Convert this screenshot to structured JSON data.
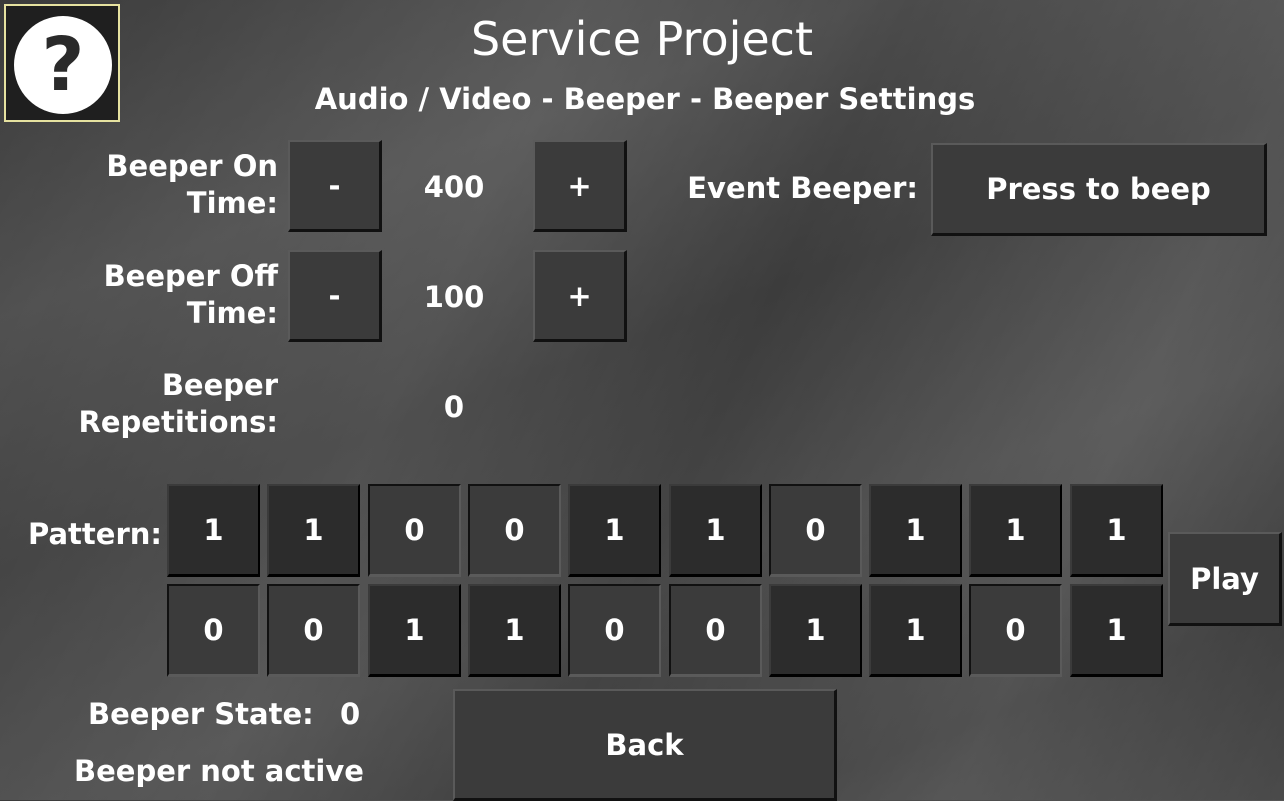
{
  "header": {
    "help_symbol": "?",
    "title": "Service Project",
    "subtitle": "Audio / Video - Beeper - Beeper Settings"
  },
  "beeper_on_time": {
    "label_line1": "Beeper On",
    "label_line2": "Time:",
    "minus": "-",
    "plus": "+",
    "value": "400"
  },
  "beeper_off_time": {
    "label_line1": "Beeper Off",
    "label_line2": "Time:",
    "minus": "-",
    "plus": "+",
    "value": "100"
  },
  "repetitions": {
    "label_line1": "Beeper",
    "label_line2": "Repetitions:",
    "value": "0"
  },
  "event_beeper": {
    "label": "Event Beeper:",
    "button": "Press to beep"
  },
  "pattern": {
    "label": "Pattern:",
    "row1": [
      "1",
      "1",
      "0",
      "0",
      "1",
      "1",
      "0",
      "1",
      "1",
      "1"
    ],
    "row2": [
      "0",
      "0",
      "1",
      "1",
      "0",
      "0",
      "1",
      "1",
      "0",
      "1"
    ],
    "play": "Play"
  },
  "status": {
    "state_label": "Beeper State:",
    "state_value": "0",
    "active_text": "Beeper not active"
  },
  "back_button": "Back",
  "colors": {
    "accent_border": "#e6e2a0",
    "background": "#3f3f3f",
    "text": "#ffffff"
  }
}
